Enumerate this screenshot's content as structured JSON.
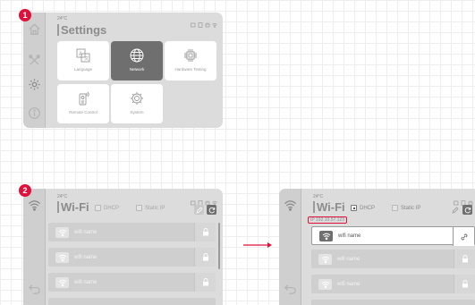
{
  "steps": [
    "1",
    "2"
  ],
  "settings_screen": {
    "temperature": "24°C",
    "title": "Settings",
    "tiles": [
      {
        "label": "Language",
        "icon": "language-icon",
        "selected": false
      },
      {
        "label": "Network",
        "icon": "globe-icon",
        "selected": true
      },
      {
        "label": "Hardware Testing",
        "icon": "chip-icon",
        "selected": false
      },
      {
        "label": "Remote Control",
        "icon": "remote-control-icon",
        "selected": false
      },
      {
        "label": "System",
        "icon": "gear-icon",
        "selected": false
      }
    ],
    "rail_icons": [
      "home-icon",
      "tools-icon",
      "settings-icon",
      "info-icon"
    ],
    "status_icons": [
      "battery-icon",
      "storage-icon",
      "usb-icon",
      "wifi-status-icon"
    ]
  },
  "wifi_screen_before": {
    "temperature": "24°C",
    "title": "Wi-Fi",
    "modes": [
      {
        "label": "DHCP",
        "checked": false
      },
      {
        "label": "Static IP",
        "checked": false
      }
    ],
    "networks": [
      "wifi name",
      "wifi name",
      "wifi name"
    ]
  },
  "wifi_screen_after": {
    "temperature": "24°C",
    "title": "Wi-Fi",
    "modes": [
      {
        "label": "DHCP",
        "checked": true
      },
      {
        "label": "Static IP",
        "checked": false
      }
    ],
    "ip_address": "IP 192.10.57.123",
    "selected_network": "wifi name",
    "networks": [
      "wifi name",
      "wifi name"
    ]
  },
  "colors": {
    "accent": "#e0103a",
    "panel": "#dcdcdc",
    "selected_tile": "#6f6f6f"
  }
}
